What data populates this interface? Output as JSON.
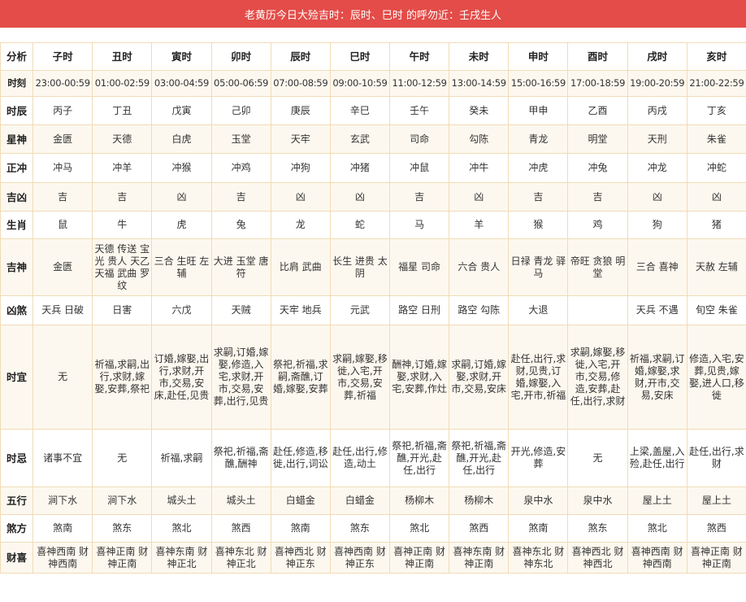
{
  "banner": "老黄历今日大殓吉时：辰时、巳时 的呼勿近：壬戌生人",
  "table": {
    "header_label": "分析",
    "hours": [
      "子时",
      "丑时",
      "寅时",
      "卯时",
      "辰时",
      "巳时",
      "午时",
      "未时",
      "申时",
      "酉时",
      "戌时",
      "亥时"
    ],
    "rows": [
      {
        "label": "时刻",
        "cells": [
          "23:00-00:59",
          "01:00-02:59",
          "03:00-04:59",
          "05:00-06:59",
          "07:00-08:59",
          "09:00-10:59",
          "11:00-12:59",
          "13:00-14:59",
          "15:00-16:59",
          "17:00-18:59",
          "19:00-20:59",
          "21:00-22:59"
        ]
      },
      {
        "label": "时辰",
        "cells": [
          "丙子",
          "丁丑",
          "戊寅",
          "己卯",
          "庚辰",
          "辛巳",
          "壬午",
          "癸未",
          "甲申",
          "乙酉",
          "丙戌",
          "丁亥"
        ]
      },
      {
        "label": "星神",
        "cells": [
          "金匮",
          "天德",
          "白虎",
          "玉堂",
          "天牢",
          "玄武",
          "司命",
          "勾陈",
          "青龙",
          "明堂",
          "天刑",
          "朱雀"
        ]
      },
      {
        "label": "正冲",
        "cells": [
          "冲马",
          "冲羊",
          "冲猴",
          "冲鸡",
          "冲狗",
          "冲猪",
          "冲鼠",
          "冲牛",
          "冲虎",
          "冲兔",
          "冲龙",
          "冲蛇"
        ]
      },
      {
        "label": "吉凶",
        "cells": [
          "吉",
          "吉",
          "凶",
          "吉",
          "凶",
          "凶",
          "吉",
          "凶",
          "吉",
          "吉",
          "凶",
          "凶"
        ]
      },
      {
        "label": "生肖",
        "cells": [
          "鼠",
          "牛",
          "虎",
          "兔",
          "龙",
          "蛇",
          "马",
          "羊",
          "猴",
          "鸡",
          "狗",
          "猪"
        ]
      },
      {
        "label": "吉神",
        "cells": [
          "金匮",
          "天德 传送 宝光 贵人 天乙 天福 武曲 罗纹",
          "三合 生旺 左辅",
          "大进 玉堂 唐符",
          "比肩 武曲",
          "长生 进贵 太阴",
          "福星 司命",
          "六合 贵人",
          "日禄 青龙 驿马",
          "帝旺 贪狼 明堂",
          "三合 喜神",
          "天赦 左辅"
        ]
      },
      {
        "label": "凶煞",
        "cells": [
          "天兵 日破",
          "日害",
          "六戊",
          "天贼",
          "天牢 地兵",
          "元武",
          "路空 日刑",
          "路空 勾陈",
          "大退",
          "",
          "天兵 不遇",
          "旬空 朱雀"
        ]
      },
      {
        "label": "时宜",
        "cells": [
          "无",
          "祈福,求嗣,出行,求财,嫁娶,安葬,祭祀",
          "订婚,嫁娶,出行,求财,开市,交易,安床,赴任,见贵",
          "求嗣,订婚,嫁娶,修造,入宅,求财,开市,交易,安葬,出行,见贵",
          "祭祀,祈福,求嗣,斋醮,订婚,嫁娶,安葬",
          "求嗣,嫁娶,移徙,入宅,开市,交易,安葬,祈福",
          "酬神,订婚,嫁娶,求财,入宅,安葬,作灶",
          "求嗣,订婚,嫁娶,求财,开市,交易,安床",
          "赴任,出行,求财,见贵,订婚,嫁娶,入宅,开市,祈福",
          "求嗣,嫁娶,移徙,入宅,开市,交易,修造,安葬,赴任,出行,求财",
          "祈福,求嗣,订婚,嫁娶,求财,开市,交易,安床",
          "修造,入宅,安葬,见贵,嫁娶,进人口,移徙"
        ]
      },
      {
        "label": "时忌",
        "cells": [
          "诸事不宜",
          "无",
          "祈福,求嗣",
          "祭祀,祈福,斋醮,酬神",
          "赴任,修造,移徙,出行,词讼",
          "赴任,出行,修造,动土",
          "祭祀,祈福,斋醮,开光,赴任,出行",
          "祭祀,祈福,斋醮,开光,赴任,出行",
          "开光,修造,安葬",
          "无",
          "上梁,盖屋,入殓,赴任,出行",
          "赴任,出行,求财"
        ]
      },
      {
        "label": "五行",
        "cells": [
          "涧下水",
          "涧下水",
          "城头土",
          "城头土",
          "白蜡金",
          "白蜡金",
          "杨柳木",
          "杨柳木",
          "泉中水",
          "泉中水",
          "屋上土",
          "屋上土"
        ]
      },
      {
        "label": "煞方",
        "cells": [
          "煞南",
          "煞东",
          "煞北",
          "煞西",
          "煞南",
          "煞东",
          "煞北",
          "煞西",
          "煞南",
          "煞东",
          "煞北",
          "煞西"
        ]
      },
      {
        "label": "财喜",
        "cells": [
          "喜神西南 财神西南",
          "喜神正南 财神正南",
          "喜神东南 财神正北",
          "喜神东北 财神正北",
          "喜神西北 财神正东",
          "喜神西南 财神正东",
          "喜神正南 财神正南",
          "喜神东南 财神正南",
          "喜神东北 财神东北",
          "喜神西北 财神西北",
          "喜神西南 财神西南",
          "喜神正南 财神正南"
        ]
      }
    ]
  }
}
